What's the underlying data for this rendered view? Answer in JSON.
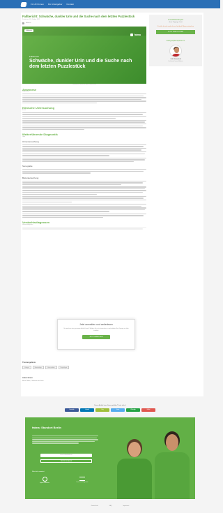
{
  "nav": {
    "items": [
      "Für Ärzt:innen",
      "Für Arbeitgeber",
      "Kontakt"
    ]
  },
  "article": {
    "title": "Fallbericht: Schwäche, dunkler Urin und die Suche nach dem letzten Puzzlestück",
    "meta": "Zuletzt am 15. Oktober 2021",
    "listen_label": "Anhören",
    "hero": {
      "badge": "Fallbericht",
      "brand": "fatma",
      "kicker": "Fallbericht",
      "headline": "Schwäche, dunkler Urin und die Suche nach dem letzten Puzzlestück"
    },
    "caption": "Medizinisches Wissen auf dem neuesten Stand",
    "sections": [
      {
        "title": "Anamnese",
        "sub": "Vorgeschichte"
      },
      {
        "title": "Klinische Untersuchung",
        "sub": "Befund"
      },
      {
        "title": "Weiterführende Diagnostik",
        "sub": "Labor"
      }
    ],
    "plain_titles": [
      "Urinuntersuchung",
      "Sonografie",
      "Blutuntersuchung"
    ],
    "last_section": {
      "title": "Verdachtsdiagnosen",
      "sub": "Differenzialdiagnosen"
    }
  },
  "login": {
    "title": "Jetzt anmelden und weiterlesen",
    "subtitle": "Sie möchten den gesamten Artikel lesen? Melden Sie sich kostenlos an und erhalten Sie Zugang zu allen Inhalten.",
    "button": "JETZT ANMELDEN"
  },
  "tags": {
    "title": "Themengebiete",
    "items": [
      "Urologie",
      "Hämatologie",
      "Labormedizin",
      "Nephrologie"
    ]
  },
  "author": {
    "title": "Autor:innen",
    "name": "Marie Pfeffer, Chefärztin der fatma"
  },
  "sidebar": {
    "t1": "Lerneffektivität jetzt",
    "t2": "ohne Zugangs-Limit",
    "t3": "Für alle, die sich mehr als nur Lehrbuch-Wissen wünschen",
    "button": "JETZT FREI KLICKEN",
    "expert_label": "Fachgesprächspartner:in",
    "expert_name": "Jule Solandski",
    "expert_role": "Fachärztin Innere Medizin"
  },
  "share": {
    "title": "Dieser Artikel kann Ihnen gefallen? Jetzt teilen!",
    "buttons": [
      {
        "label": "Facebook",
        "color": "#3b5998"
      },
      {
        "label": "LinkedIn",
        "color": "#0077b5"
      },
      {
        "label": "Xing",
        "color": "#9fbf3a"
      },
      {
        "label": "Twitter",
        "color": "#55acee"
      },
      {
        "label": "WhatsApp",
        "color": "#25a244"
      },
      {
        "label": "E-Mail",
        "color": "#e0574f"
      }
    ]
  },
  "promo": {
    "title": "fatma: Standort Berlin",
    "field_placeholder": "Deine E-Mail-Adresse",
    "button": "WEITER SCHAUEN",
    "vision_label": "Was dich erwartet",
    "features": [
      "Digitale Fallberichte",
      "Lernen mit Kolleg:innen",
      "Kostenfreie Fortbildung"
    ]
  },
  "footer": {
    "links": [
      "Datenschutz",
      "FAQ",
      "Impressum"
    ]
  }
}
